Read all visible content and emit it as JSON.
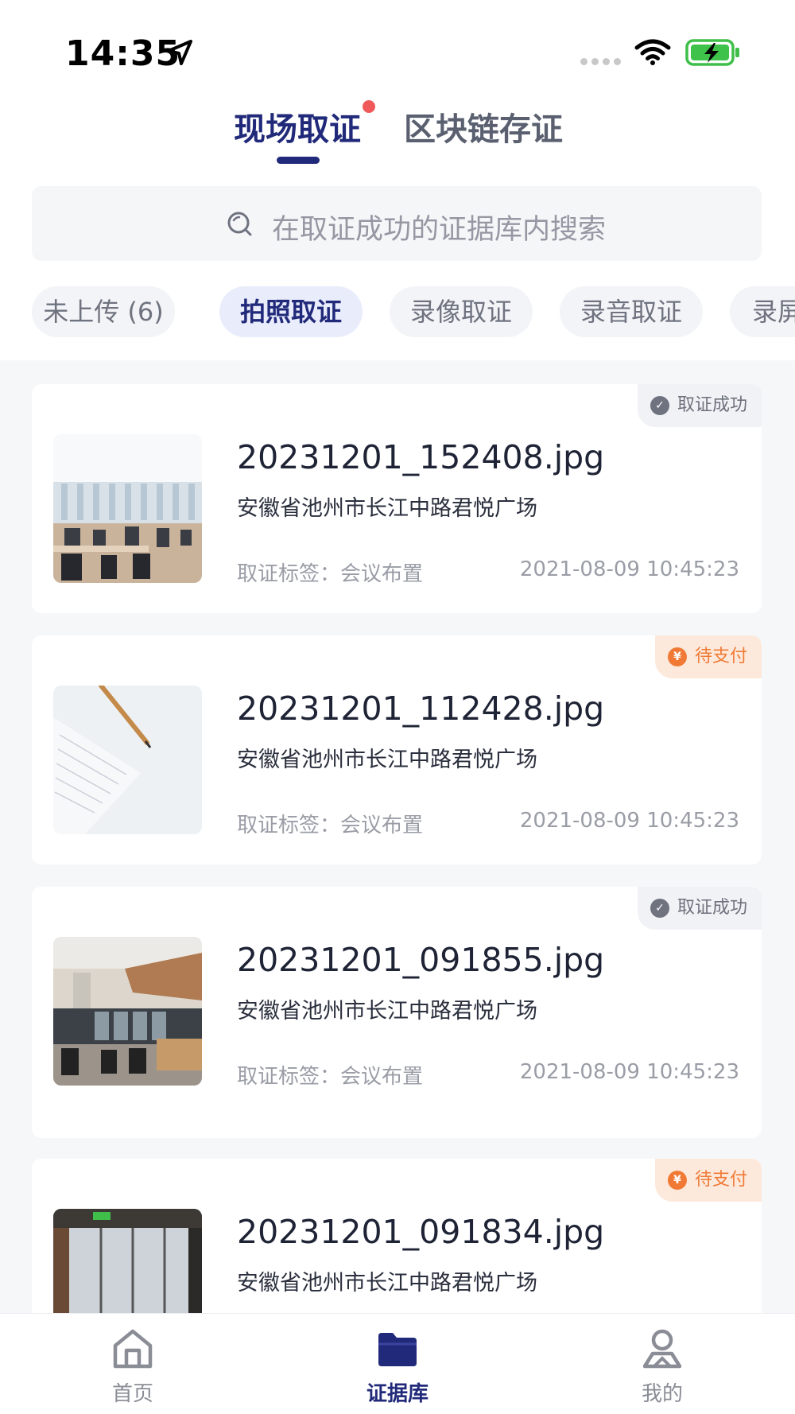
{
  "status_bar": {
    "time": "14:35"
  },
  "top_tabs": [
    {
      "label": "现场取证",
      "active": true,
      "has_dot": true
    },
    {
      "label": "区块链存证",
      "active": false
    }
  ],
  "search": {
    "placeholder": "在取证成功的证据库内搜索"
  },
  "filters": [
    {
      "label": "未上传 (6)",
      "active": false
    },
    {
      "label": "拍照取证",
      "active": true
    },
    {
      "label": "录像取证",
      "active": false
    },
    {
      "label": "录音取证",
      "active": false
    },
    {
      "label": "录屏",
      "active": false
    }
  ],
  "records": [
    {
      "filename": "20231201_152408.jpg",
      "address": "安徽省池州市长江中路君悦广场",
      "tag": "取证标签：会议布置",
      "datetime": "2021-08-09 10:45:23",
      "status": "取证成功",
      "status_type": "success"
    },
    {
      "filename": "20231201_112428.jpg",
      "address": "安徽省池州市长江中路君悦广场",
      "tag": "取证标签：会议布置",
      "datetime": "2021-08-09 10:45:23",
      "status": "待支付",
      "status_type": "pending"
    },
    {
      "filename": "20231201_091855.jpg",
      "address": "安徽省池州市长江中路君悦广场",
      "tag": "取证标签：会议布置",
      "datetime": "2021-08-09 10:45:23",
      "status": "取证成功",
      "status_type": "success"
    },
    {
      "filename": "20231201_091834.jpg",
      "address": "安徽省池州市长江中路君悦广场",
      "tag": "",
      "datetime": "",
      "status": "待支付",
      "status_type": "pending"
    }
  ],
  "bottom_nav": [
    {
      "label": "首页",
      "icon": "home-icon",
      "active": false
    },
    {
      "label": "证据库",
      "icon": "folder-icon",
      "active": true
    },
    {
      "label": "我的",
      "icon": "profile-icon",
      "active": false
    }
  ],
  "colors": {
    "primary": "#212a7a",
    "pending": "#f07a35",
    "success_badge": "#6f7380",
    "list_background": "#f6f7f9"
  }
}
